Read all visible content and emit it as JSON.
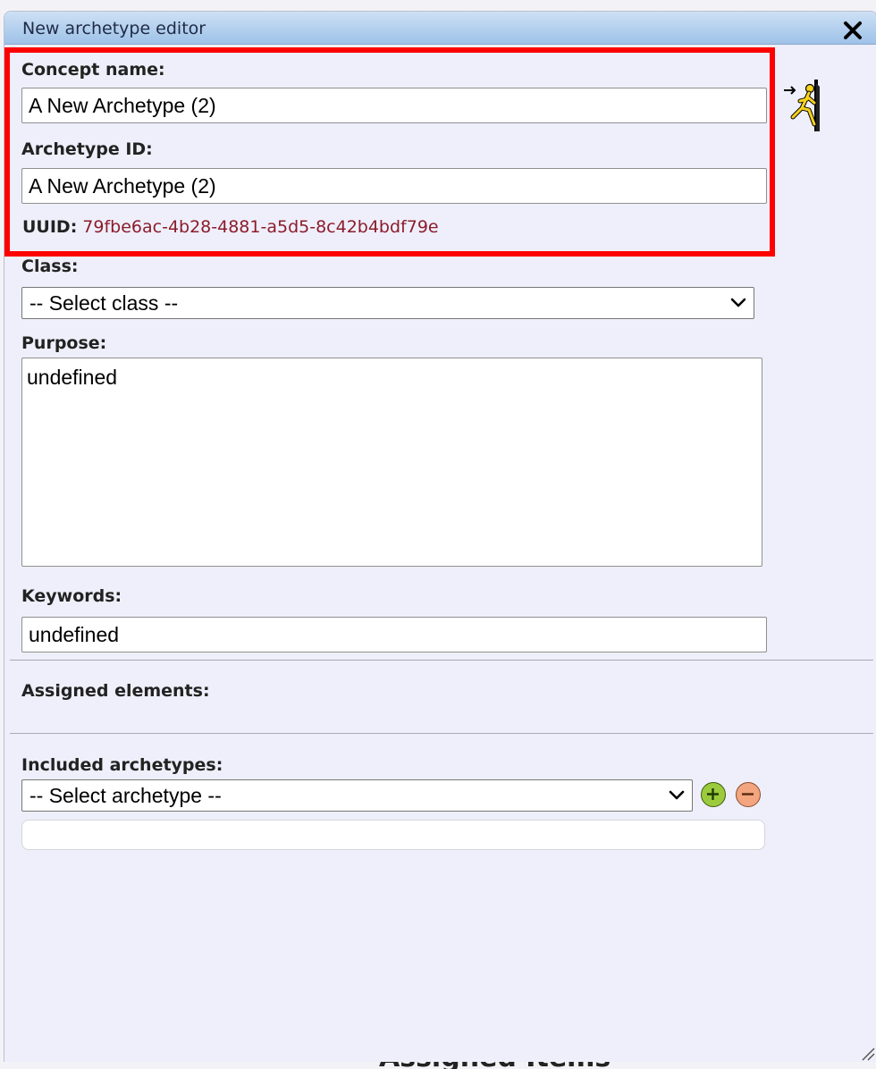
{
  "dialog": {
    "title": "New archetype editor",
    "close_symbol": "✕"
  },
  "concept": {
    "label": "Concept name:",
    "value": "A New Archetype (2)"
  },
  "archetype_id": {
    "label": "Archetype ID:",
    "value": "A New Archetype (2)"
  },
  "uuid": {
    "label": "UUID:",
    "value": "79fbe6ac-4b28-4881-a5d5-8c42b4bdf79e"
  },
  "class_field": {
    "label": "Class:",
    "selected": "-- Select class --"
  },
  "purpose": {
    "label": "Purpose:",
    "value": "undefined"
  },
  "keywords": {
    "label": "Keywords:",
    "value": "undefined"
  },
  "assigned_elements": {
    "label": "Assigned elements:"
  },
  "included_archetypes": {
    "label": "Included archetypes:",
    "selected": "-- Select archetype --",
    "add_icon": "plus-circle-icon",
    "remove_icon": "minus-circle-icon"
  },
  "bottom_heading": "Assigned Items",
  "icons": {
    "exit": "exit-door-icon",
    "resize": "resize-grip-icon"
  },
  "colors": {
    "titlebar": "#b7d2ef",
    "uuid_value": "#8b1c2b",
    "highlight": "#ff0000",
    "add_button": "#9bcb3c",
    "remove_button": "#f2a57e"
  }
}
